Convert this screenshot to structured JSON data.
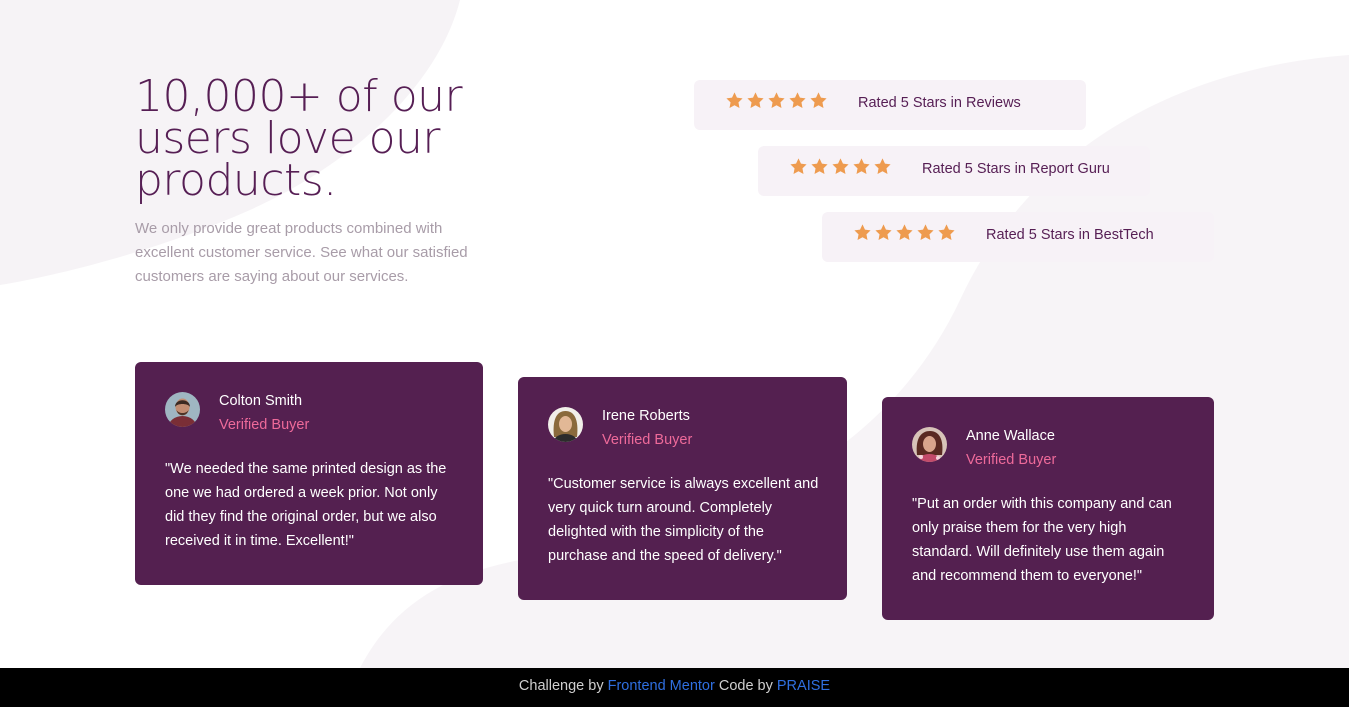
{
  "hero": {
    "title": "10,000+ of our users love our products.",
    "description": "We only provide great products combined with excellent customer service. See what our satisfied customers are saying about our services."
  },
  "ratings": [
    {
      "label": "Rated 5 Stars in Reviews",
      "stars": 5
    },
    {
      "label": "Rated 5 Stars in Report Guru",
      "stars": 5
    },
    {
      "label": "Rated 5 Stars in BestTech",
      "stars": 5
    }
  ],
  "testimonials": [
    {
      "name": "Colton Smith",
      "badge": "Verified Buyer",
      "quote": "\"We needed the same printed design as the one we had ordered a week prior. Not only did they find the original order, but we also received it in time. Excellent!\""
    },
    {
      "name": "Irene Roberts",
      "badge": "Verified Buyer",
      "quote": "\"Customer service is always excellent and very quick turn around. Completely delighted with the simplicity of the purchase and the speed of delivery.\""
    },
    {
      "name": "Anne Wallace",
      "badge": "Verified Buyer",
      "quote": "\"Put an order with this company and can only praise them for the very high standard. Will definitely use them again and recommend them to everyone!\""
    }
  ],
  "footer": {
    "prefix": "Challenge by",
    "challenge_link": "Frontend Mentor",
    "middle": "Code by",
    "author_link": "PRAISE"
  },
  "colors": {
    "accent": "#561e54",
    "card_bg": "#542050",
    "rating_bg": "#f7f2f7",
    "star": "#ee9b4f",
    "verified": "#ee6a9a"
  },
  "icons": {
    "star": "star-icon",
    "avatar": "avatar"
  }
}
